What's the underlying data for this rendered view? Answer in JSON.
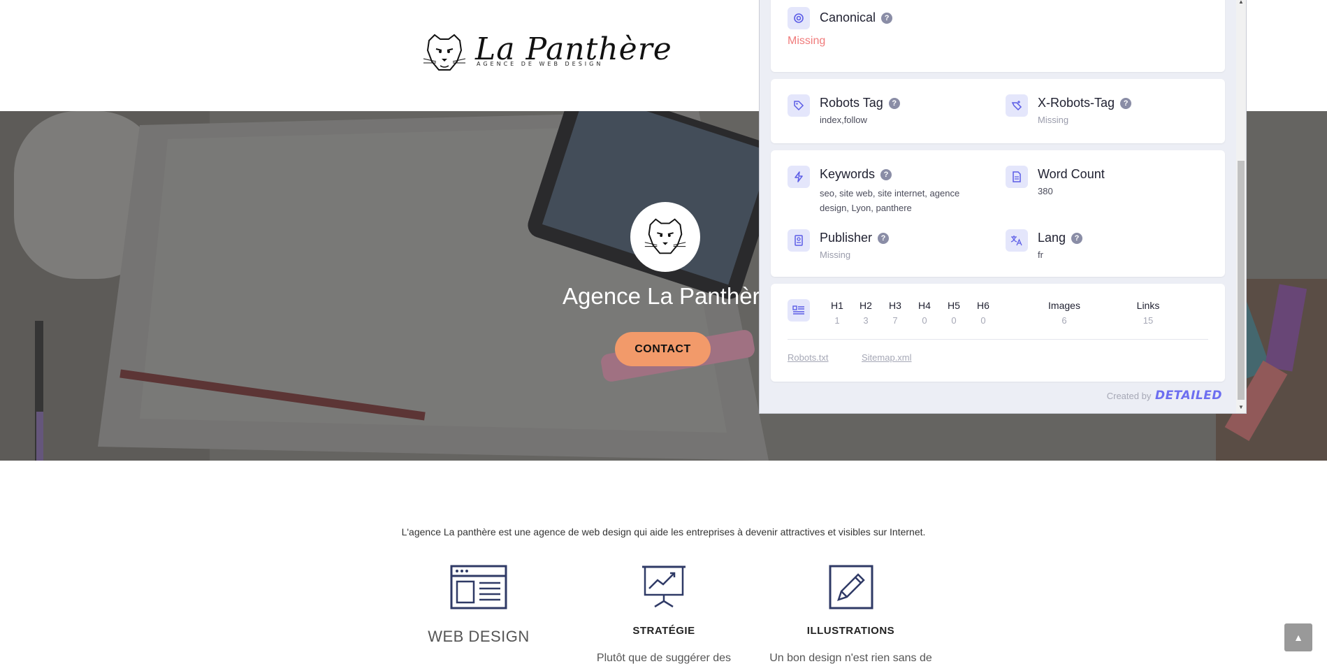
{
  "site": {
    "logo_name": "La Panthère",
    "logo_tagline": "AGENCE DE WEB DESIGN"
  },
  "hero": {
    "title": "Agence La Panthère",
    "contact_label": "CONTACT"
  },
  "intro": "L'agence La panthère est une agence de web design qui aide les entreprises à devenir attractives et visibles sur Internet.",
  "services": [
    {
      "title": "WEB DESIGN",
      "icon": "browser-layout-icon",
      "text": ""
    },
    {
      "title": "STRATÉGIE",
      "icon": "presentation-chart-icon",
      "text": "Plutôt que de suggérer des"
    },
    {
      "title": "ILLUSTRATIONS",
      "icon": "pencil-icon",
      "text": "Un bon design n'est rien sans de"
    }
  ],
  "panel": {
    "canonical": {
      "label": "Canonical",
      "value": "Missing",
      "icon": "target-icon"
    },
    "robots_tag": {
      "label": "Robots Tag",
      "value": "index,follow",
      "icon": "tag-icon"
    },
    "x_robots_tag": {
      "label": "X-Robots-Tag",
      "value": "Missing",
      "icon": "tag-plus-icon"
    },
    "keywords": {
      "label": "Keywords",
      "value_line1": "seo, site web, site internet, agence",
      "value_line2": "design, Lyon, panthere",
      "icon": "bolt-icon"
    },
    "word_count": {
      "label": "Word Count",
      "value": "380",
      "icon": "document-icon"
    },
    "publisher": {
      "label": "Publisher",
      "value": "Missing",
      "icon": "id-badge-icon"
    },
    "lang": {
      "label": "Lang",
      "value": "fr",
      "icon": "translate-icon"
    },
    "headings": [
      {
        "label": "H1",
        "count": "1"
      },
      {
        "label": "H2",
        "count": "3"
      },
      {
        "label": "H3",
        "count": "7"
      },
      {
        "label": "H4",
        "count": "0"
      },
      {
        "label": "H5",
        "count": "0"
      },
      {
        "label": "H6",
        "count": "0"
      }
    ],
    "images": {
      "label": "Images",
      "count": "6"
    },
    "links": {
      "label": "Links",
      "count": "15"
    },
    "robots_link": "Robots.txt",
    "sitemap_link": "Sitemap.xml",
    "credit_prefix": "Created by",
    "credit_brand": "DETAILED",
    "help_glyph": "?"
  },
  "scroll_top_glyph": "▲",
  "colors": {
    "accent": "#f29a6a",
    "panel_bg": "#eceef5",
    "icon_bg": "#e4e6fb",
    "icon_fg": "#5b5ce6",
    "missing": "#f07b7b",
    "brand": "#6c6ef0"
  }
}
